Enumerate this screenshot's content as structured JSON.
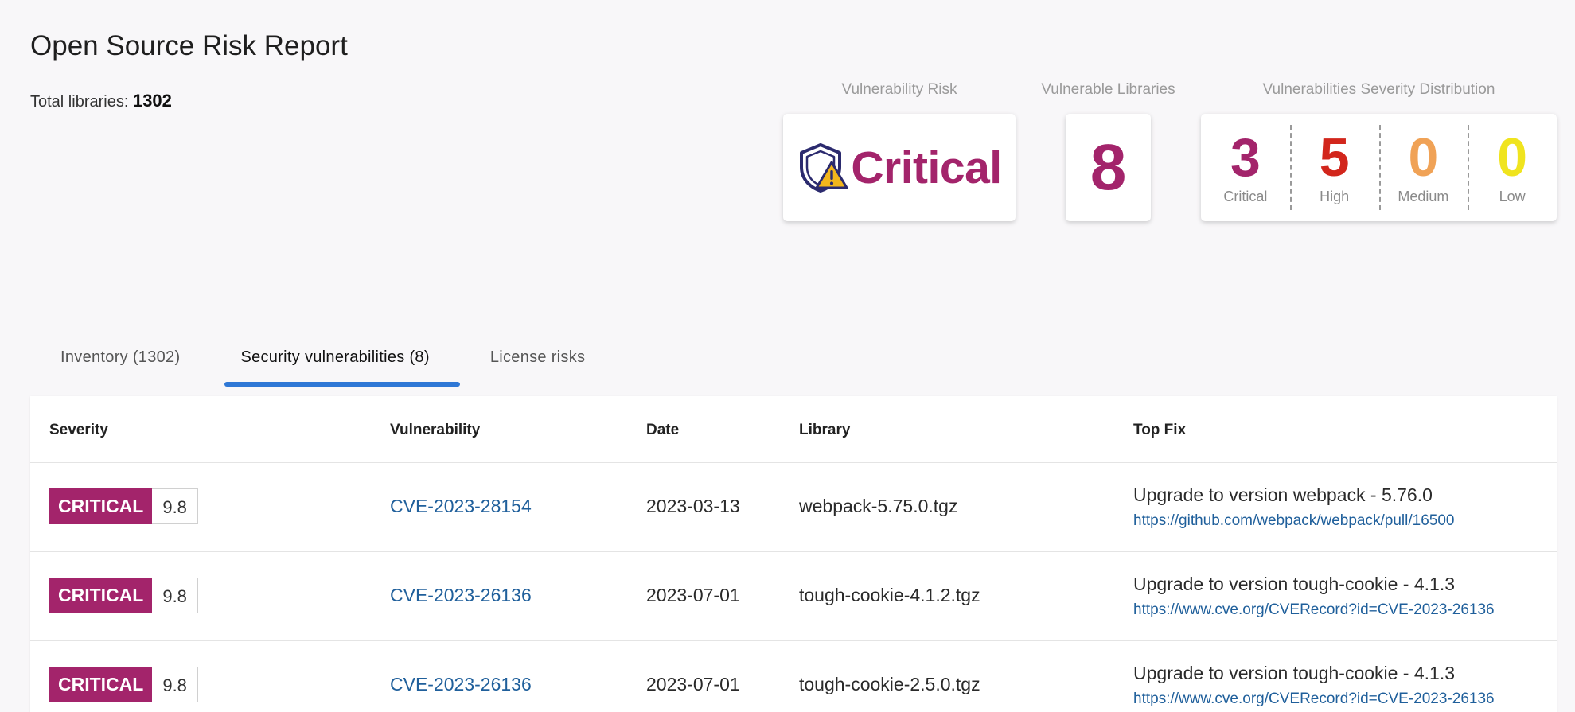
{
  "header": {
    "title": "Open Source Risk Report",
    "total_label": "Total libraries:",
    "total_value": "1302"
  },
  "metrics": {
    "risk": {
      "label": "Vulnerability Risk",
      "value": "Critical",
      "color": "#a3246b",
      "icon": "shield-warning-icon"
    },
    "libraries": {
      "label": "Vulnerable Libraries",
      "value": "8"
    },
    "distribution": {
      "label": "Vulnerabilities Severity Distribution",
      "items": [
        {
          "count": "3",
          "label": "Critical",
          "color": "#a3246b"
        },
        {
          "count": "5",
          "label": "High",
          "color": "#d2261c"
        },
        {
          "count": "0",
          "label": "Medium",
          "color": "#f0a256"
        },
        {
          "count": "0",
          "label": "Low",
          "color": "#f0e41e"
        }
      ]
    }
  },
  "tabs": [
    {
      "label": "Inventory (1302)",
      "active": false
    },
    {
      "label": "Security vulnerabilities (8)",
      "active": true
    },
    {
      "label": "License risks",
      "active": false
    }
  ],
  "table": {
    "columns": [
      "Severity",
      "Vulnerability",
      "Date",
      "Library",
      "Top Fix"
    ],
    "rows": [
      {
        "severity": "CRITICAL",
        "score": "9.8",
        "cve": "CVE-2023-28154",
        "date": "2023-03-13",
        "library": "webpack-5.75.0.tgz",
        "fix": "Upgrade to version webpack - 5.76.0",
        "fix_link": "https://github.com/webpack/webpack/pull/16500"
      },
      {
        "severity": "CRITICAL",
        "score": "9.8",
        "cve": "CVE-2023-26136",
        "date": "2023-07-01",
        "library": "tough-cookie-4.1.2.tgz",
        "fix": "Upgrade to version tough-cookie - 4.1.3",
        "fix_link": "https://www.cve.org/CVERecord?id=CVE-2023-26136"
      },
      {
        "severity": "CRITICAL",
        "score": "9.8",
        "cve": "CVE-2023-26136",
        "date": "2023-07-01",
        "library": "tough-cookie-2.5.0.tgz",
        "fix": "Upgrade to version tough-cookie - 4.1.3",
        "fix_link": "https://www.cve.org/CVERecord?id=CVE-2023-26136"
      }
    ]
  }
}
